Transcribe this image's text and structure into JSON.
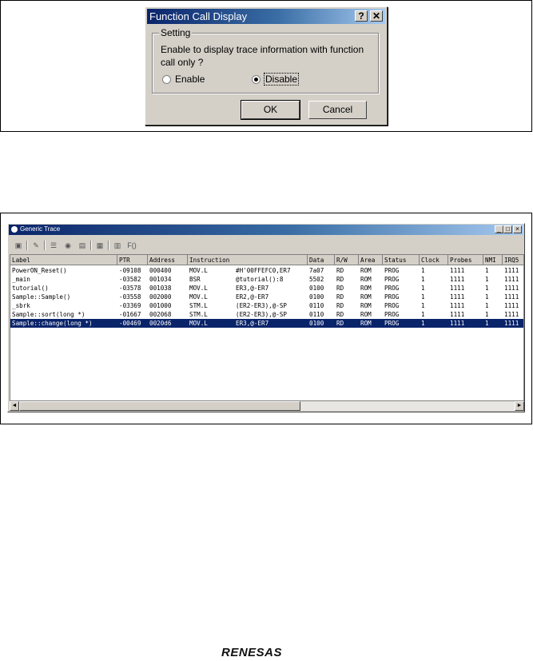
{
  "dialog": {
    "title": "Function Call Display",
    "help_label": "?",
    "close_label": "✕",
    "group_label": "Setting",
    "prompt": "Enable to display trace information with function call only ?",
    "options": [
      {
        "label": "Enable",
        "checked": false
      },
      {
        "label": "Disable",
        "checked": true
      }
    ],
    "ok_label": "OK",
    "cancel_label": "Cancel"
  },
  "trace": {
    "title": "Generic Trace",
    "min_label": "_",
    "max_label": "□",
    "close_label": "×",
    "toolbar_text": "F()",
    "columns": [
      "Label",
      "PTR",
      "Address",
      "Instruction",
      "",
      "Data",
      "R/W",
      "Area",
      "Status",
      "Clock",
      "Probes",
      "NMI",
      "IRQ5"
    ],
    "rows": [
      [
        "PowerON_Reset()",
        "-09108",
        "000400",
        "MOV.L",
        "#H'00FFEFC0,ER7",
        "7a07",
        "RD",
        "ROM",
        "PROG",
        "1",
        "1111",
        "1",
        "1111"
      ],
      [
        "_main",
        "-03582",
        "001034",
        "BSR",
        "@tutorial():8",
        "5502",
        "RD",
        "ROM",
        "PROG",
        "1",
        "1111",
        "1",
        "1111"
      ],
      [
        "tutorial()",
        "-03578",
        "001038",
        "MOV.L",
        "ER3,@-ER7",
        "0100",
        "RD",
        "ROM",
        "PROG",
        "1",
        "1111",
        "1",
        "1111"
      ],
      [
        "Sample::Sample()",
        "-03558",
        "002000",
        "MOV.L",
        "ER2,@-ER7",
        "0100",
        "RD",
        "ROM",
        "PROG",
        "1",
        "1111",
        "1",
        "1111"
      ],
      [
        "_sbrk",
        "-03369",
        "001000",
        "STM.L",
        "(ER2-ER3),@-SP",
        "0110",
        "RD",
        "ROM",
        "PROG",
        "1",
        "1111",
        "1",
        "1111"
      ],
      [
        "Sample::sort(long *)",
        "-01667",
        "002068",
        "STM.L",
        "(ER2-ER3),@-SP",
        "0110",
        "RD",
        "ROM",
        "PROG",
        "1",
        "1111",
        "1",
        "1111"
      ],
      [
        "Sample::change(long *)",
        "-00469",
        "0020d6",
        "MOV.L",
        "ER3,@-ER7",
        "0100",
        "RD",
        "ROM",
        "PROG",
        "1",
        "1111",
        "1",
        "1111"
      ]
    ],
    "selected_row": 6,
    "scroll_left": "◄",
    "scroll_right": "►"
  },
  "logo": "RENESAS",
  "colors": {
    "title_blue": "#0a246a",
    "face": "#d4d0c8",
    "selection": "#0a246a"
  }
}
